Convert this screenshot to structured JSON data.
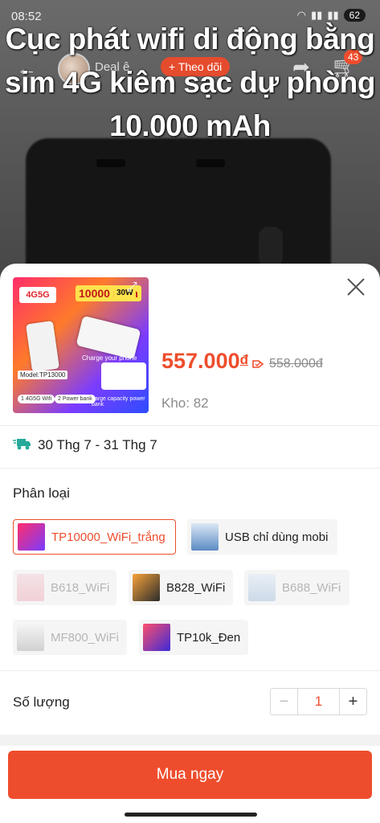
{
  "status_bar": {
    "time": "08:52",
    "battery": "62"
  },
  "video": {
    "title": "Cục phát wifi di động bằng sim 4G kiêm sạc dự phòng 10.000 mAh",
    "shop_name": "Deal ê",
    "follow_label": "+ Theo dõi",
    "cart_count": "43"
  },
  "product": {
    "thumb": {
      "brand": "4G5G",
      "capacity": "10000 mAh",
      "power": "30W",
      "charge_text": "Charge your phone",
      "model": "Model:TP13000",
      "feature1": "1 4G5G Wifi",
      "feature2": "2 Power bank",
      "bottom_text": "Large capacity power bank"
    },
    "price": "557.000",
    "currency": "đ",
    "old_price": "558.000đ",
    "stock": "Kho: 82"
  },
  "delivery": {
    "text": "30 Thg 7 - 31 Thg 7"
  },
  "variants": {
    "title": "Phân loại",
    "options": [
      {
        "label": "TP10000_WiFi_trắng",
        "state": "selected"
      },
      {
        "label": "USB chỉ dùng mobi",
        "state": "normal"
      },
      {
        "label": "B618_WiFi",
        "state": "disabled"
      },
      {
        "label": "B828_WiFi",
        "state": "normal"
      },
      {
        "label": "B688_WiFi",
        "state": "disabled"
      },
      {
        "label": "MF800_WiFi",
        "state": "disabled"
      },
      {
        "label": "TP10k_Đen",
        "state": "normal"
      }
    ]
  },
  "quantity": {
    "label": "Số lượng",
    "value": "1"
  },
  "buy_button": {
    "label": "Mua ngay"
  },
  "colors": {
    "accent": "#ee4d2d"
  }
}
